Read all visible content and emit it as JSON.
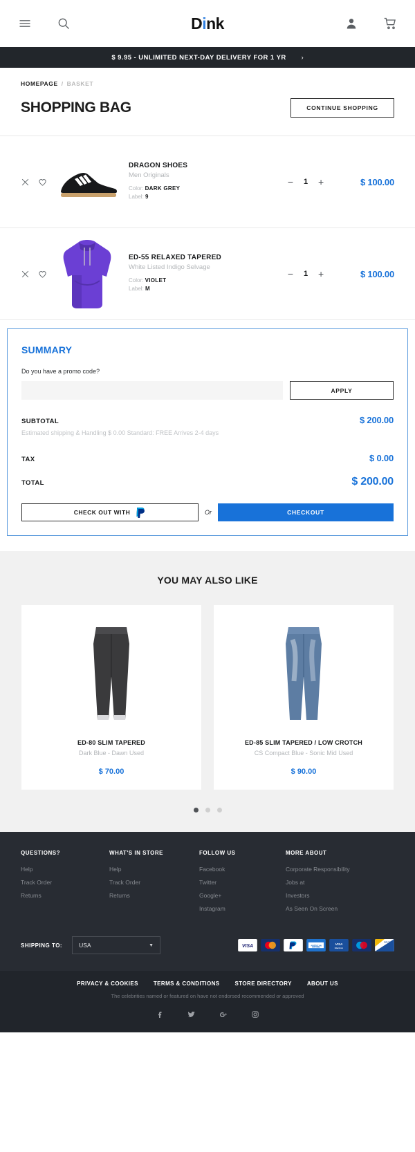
{
  "header": {
    "brand_name": "Dink",
    "brand_accent": "#2f7fe0",
    "menu_icon": "hamburger-menu-icon",
    "search_icon": "search-icon",
    "account_icon": "user-account-icon",
    "cart_icon": "shopping-cart-icon"
  },
  "promo": {
    "text": "$ 9.95 - UNLIMITED NEXT-DAY DELIVERY FOR 1 YR",
    "arrow": "›"
  },
  "breadcrumb": {
    "home": "HOMEPAGE",
    "separator": "/",
    "current": "BASKET"
  },
  "page": {
    "title": "SHOPPING BAG",
    "continue_shopping": "CONTINUE SHOPPING"
  },
  "cart_items": [
    {
      "name": "DRAGON SHOES",
      "subtitle": "Men Originals",
      "color_label": "Color:",
      "color_value": "DARK GREY",
      "size_label": "Label:",
      "size_value": "9",
      "quantity": "1",
      "price": "$ 100.00",
      "minus": "−",
      "plus": "+"
    },
    {
      "name": "ED-55 RELAXED TAPERED",
      "subtitle": "White Listed Indigo Selvage",
      "color_label": "Color:",
      "color_value": "VIOLET",
      "size_label": "Label:",
      "size_value": "M",
      "quantity": "1",
      "price": "$ 100.00",
      "minus": "−",
      "plus": "+"
    }
  ],
  "summary": {
    "title": "SUMMARY",
    "promo_question": "Do you have a promo code?",
    "promo_placeholder": "",
    "promo_value": "",
    "apply_label": "APPLY",
    "subtotal_label": "SUBTOTAL",
    "subtotal_value": "$ 200.00",
    "shipping_note": "Estimated shipping & Handling $ 0.00 Standard: FREE Arrives 2-4 days",
    "tax_label": "TAX",
    "tax_value": "$ 0.00",
    "total_label": "TOTAL",
    "total_value": "$ 200.00",
    "paypal_label": "CHECK OUT WITH",
    "or_label": "Or",
    "checkout_label": "CHECKOUT",
    "accent_color": "#1872d9"
  },
  "recommendations": {
    "title": "YOU MAY ALSO LIKE",
    "products": [
      {
        "name": "ED-80 SLIM TAPERED",
        "subtitle": "Dark Blue - Dawn Used",
        "price": "$ 70.00"
      },
      {
        "name": "ED-85 SLIM TAPERED / LOW CROTCH",
        "subtitle": "CS Compact Blue - Sonic Mid Used",
        "price": "$ 90.00"
      }
    ],
    "carousel_dots": 3,
    "active_dot": 0
  },
  "footer": {
    "columns": [
      {
        "heading": "QUESTIONS?",
        "links": [
          "Help",
          "Track Order",
          "Returns"
        ]
      },
      {
        "heading": "WHAT'S IN STORE",
        "links": [
          "Help",
          "Track Order",
          "Returns"
        ]
      },
      {
        "heading": "FOLLOW US",
        "links": [
          "Facebook",
          "Twitter",
          "Google+",
          "Instagram"
        ]
      },
      {
        "heading": "MORE ABOUT",
        "links": [
          "Corporate Responsibility",
          "Jobs at",
          "Investors",
          "As Seen On Screen"
        ]
      }
    ],
    "shipping_label": "SHIPPING TO:",
    "shipping_value": "USA",
    "payment_methods": [
      "VISA",
      "MasterCard",
      "PayPal",
      "American Express",
      "Visa Electron",
      "Maestro",
      "Delta"
    ],
    "legal_links": [
      "PRIVACY & COOKIES",
      "TERMS & CONDITIONS",
      "STORE DIRECTORY",
      "ABOUT US"
    ],
    "disclaimer": "The celebrities named or featured on have not endorsed recommended or approved",
    "social_icons": [
      "facebook-icon",
      "twitter-icon",
      "google-plus-icon",
      "instagram-icon"
    ]
  }
}
